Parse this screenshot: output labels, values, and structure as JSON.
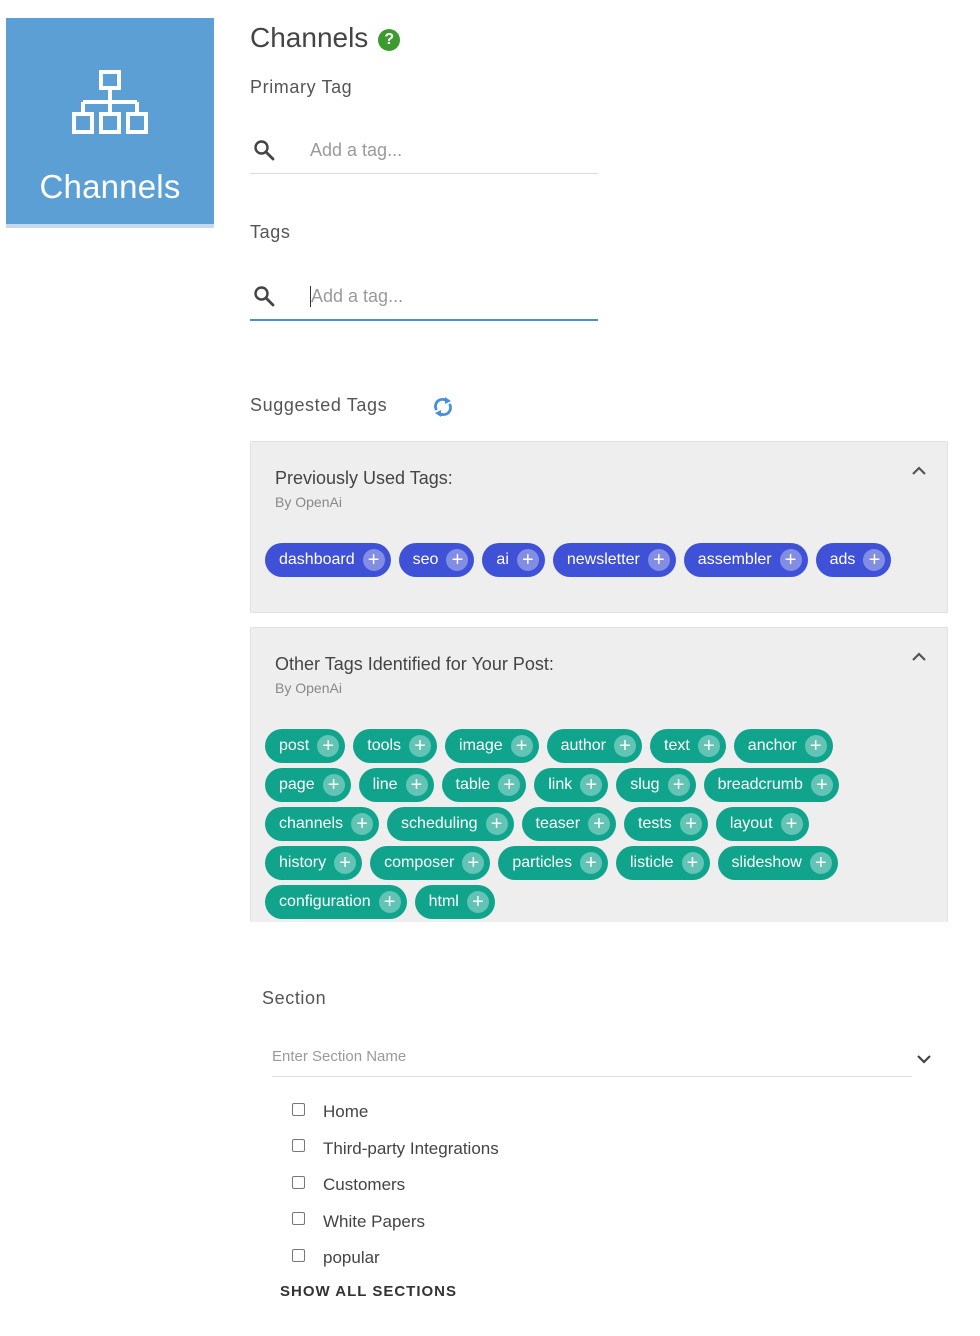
{
  "tile": {
    "label": "Channels",
    "icon": "sitemap-icon"
  },
  "header": {
    "title": "Channels",
    "help_icon": "question-mark-icon",
    "help_glyph": "?"
  },
  "primary_tag": {
    "label": "Primary Tag",
    "placeholder": "Add a tag..."
  },
  "tags": {
    "label": "Tags",
    "placeholder": "Add a tag..."
  },
  "suggested": {
    "label": "Suggested Tags",
    "refresh_icon": "refresh-icon"
  },
  "previously_used": {
    "title": "Previously Used Tags:",
    "subtitle": "By OpenAi",
    "chips": [
      "dashboard",
      "seo",
      "ai",
      "newsletter",
      "assembler",
      "ads"
    ]
  },
  "other_tags": {
    "title": "Other Tags Identified for Your Post:",
    "subtitle": "By OpenAi",
    "chips": [
      "post",
      "tools",
      "image",
      "author",
      "text",
      "anchor",
      "page",
      "line",
      "table",
      "link",
      "slug",
      "breadcrumb",
      "channels",
      "scheduling",
      "teaser",
      "tests",
      "layout",
      "history",
      "composer",
      "particles",
      "listicle",
      "slideshow",
      "configuration",
      "html"
    ]
  },
  "section": {
    "label": "Section",
    "placeholder": "Enter Section Name",
    "options": [
      "Home",
      "Third-party Integrations",
      "Customers",
      "White Papers",
      "popular"
    ],
    "show_all": "SHOW ALL SECTIONS"
  },
  "colors": {
    "tile": "#5b9fd5",
    "chip_blue": "#3f51d6",
    "chip_green": "#10a48c",
    "help": "#3c9a2e",
    "refresh": "#4a90d9"
  }
}
